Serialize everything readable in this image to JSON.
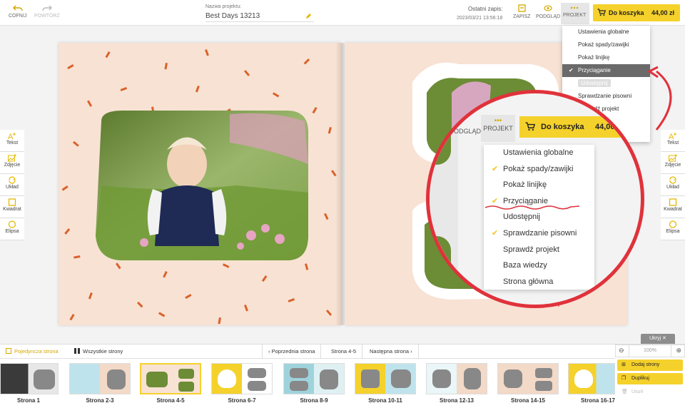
{
  "topbar": {
    "undo_label": "COFNIJ",
    "redo_label": "POWTÓRZ",
    "project_name_label": "Nazwa projektu:",
    "project_name_value": "Best Days 13213",
    "last_save_label": "Ostatni zapis:",
    "last_save_value": "2023/03/21 13:56:18",
    "save_label": "ZAPISZ",
    "preview_label": "PODGLĄD",
    "project_label": "PROJEKT",
    "cart_label": "Do koszyka",
    "cart_price": "44,00 zł"
  },
  "project_menu": {
    "items": [
      {
        "label": "Ustawienia globalne",
        "checked": false
      },
      {
        "label": "Pokaż spady/zawijki",
        "checked": false
      },
      {
        "label": "Pokaż linijkę",
        "checked": false
      },
      {
        "label": "Przyciąganie",
        "checked": true,
        "active": true
      },
      {
        "label": "Udostępnij",
        "checked": false,
        "disabled": true
      },
      {
        "label": "Sprawdzanie pisowni",
        "checked": false
      },
      {
        "label": "Sprawdź projekt",
        "checked": false
      }
    ]
  },
  "magnifier": {
    "preview_label": "PODGLĄD",
    "project_label": "PROJEKT",
    "cart_label": "Do koszyka",
    "cart_price": "44,00",
    "items": [
      {
        "label": "Ustawienia globalne",
        "checked": false
      },
      {
        "label": "Pokaż spady/zawijki",
        "checked": true
      },
      {
        "label": "Pokaż linijkę",
        "checked": false
      },
      {
        "label": "Przyciąganie",
        "checked": true
      },
      {
        "label": "Udostępnij",
        "checked": false
      },
      {
        "label": "Sprawdzanie pisowni",
        "checked": true
      },
      {
        "label": "Sprawdź projekt",
        "checked": false
      },
      {
        "label": "Baza wiedzy",
        "checked": false
      },
      {
        "label": "Strona główna",
        "checked": false
      }
    ]
  },
  "left_tools": [
    {
      "label": "Tekst",
      "icon": "text-add-icon"
    },
    {
      "label": "Zdjęcie",
      "icon": "image-add-icon"
    },
    {
      "label": "Układ",
      "icon": "layout-icon"
    },
    {
      "label": "Kwadrat",
      "icon": "square-icon"
    },
    {
      "label": "Elipsa",
      "icon": "ellipse-icon"
    }
  ],
  "right_tools": [
    {
      "label": "Tekst",
      "icon": "text-add-icon"
    },
    {
      "label": "Zdjęcie",
      "icon": "image-add-icon"
    },
    {
      "label": "Układ",
      "icon": "layout-icon"
    },
    {
      "label": "Kwadrat",
      "icon": "square-icon"
    },
    {
      "label": "Elipsa",
      "icon": "ellipse-icon"
    }
  ],
  "bottom": {
    "tab_single": "Pojedyncza strona",
    "tab_all": "Wszystkie strony",
    "prev_page": "Poprzednia strona",
    "current_page": "Strona 4-5",
    "next_page": "Następna strona",
    "hide_label": "Ukryj",
    "zoom": "100%",
    "add_pages": "Dodaj strony",
    "duplicate": "Duplikuj",
    "delete": "Usuń",
    "thumbnails": [
      {
        "label": "Strona 1"
      },
      {
        "label": "Strona 2-3"
      },
      {
        "label": "Strona 4-5",
        "selected": true
      },
      {
        "label": "Strona 6-7"
      },
      {
        "label": "Strona 8-9"
      },
      {
        "label": "Strona 10-11"
      },
      {
        "label": "Strona 12-13"
      },
      {
        "label": "Strona 14-15"
      },
      {
        "label": "Strona 16-17"
      }
    ]
  },
  "colors": {
    "accent": "#f5d12b",
    "page_bg": "#f8e2d4",
    "magnifier_ring": "#e0323b"
  }
}
